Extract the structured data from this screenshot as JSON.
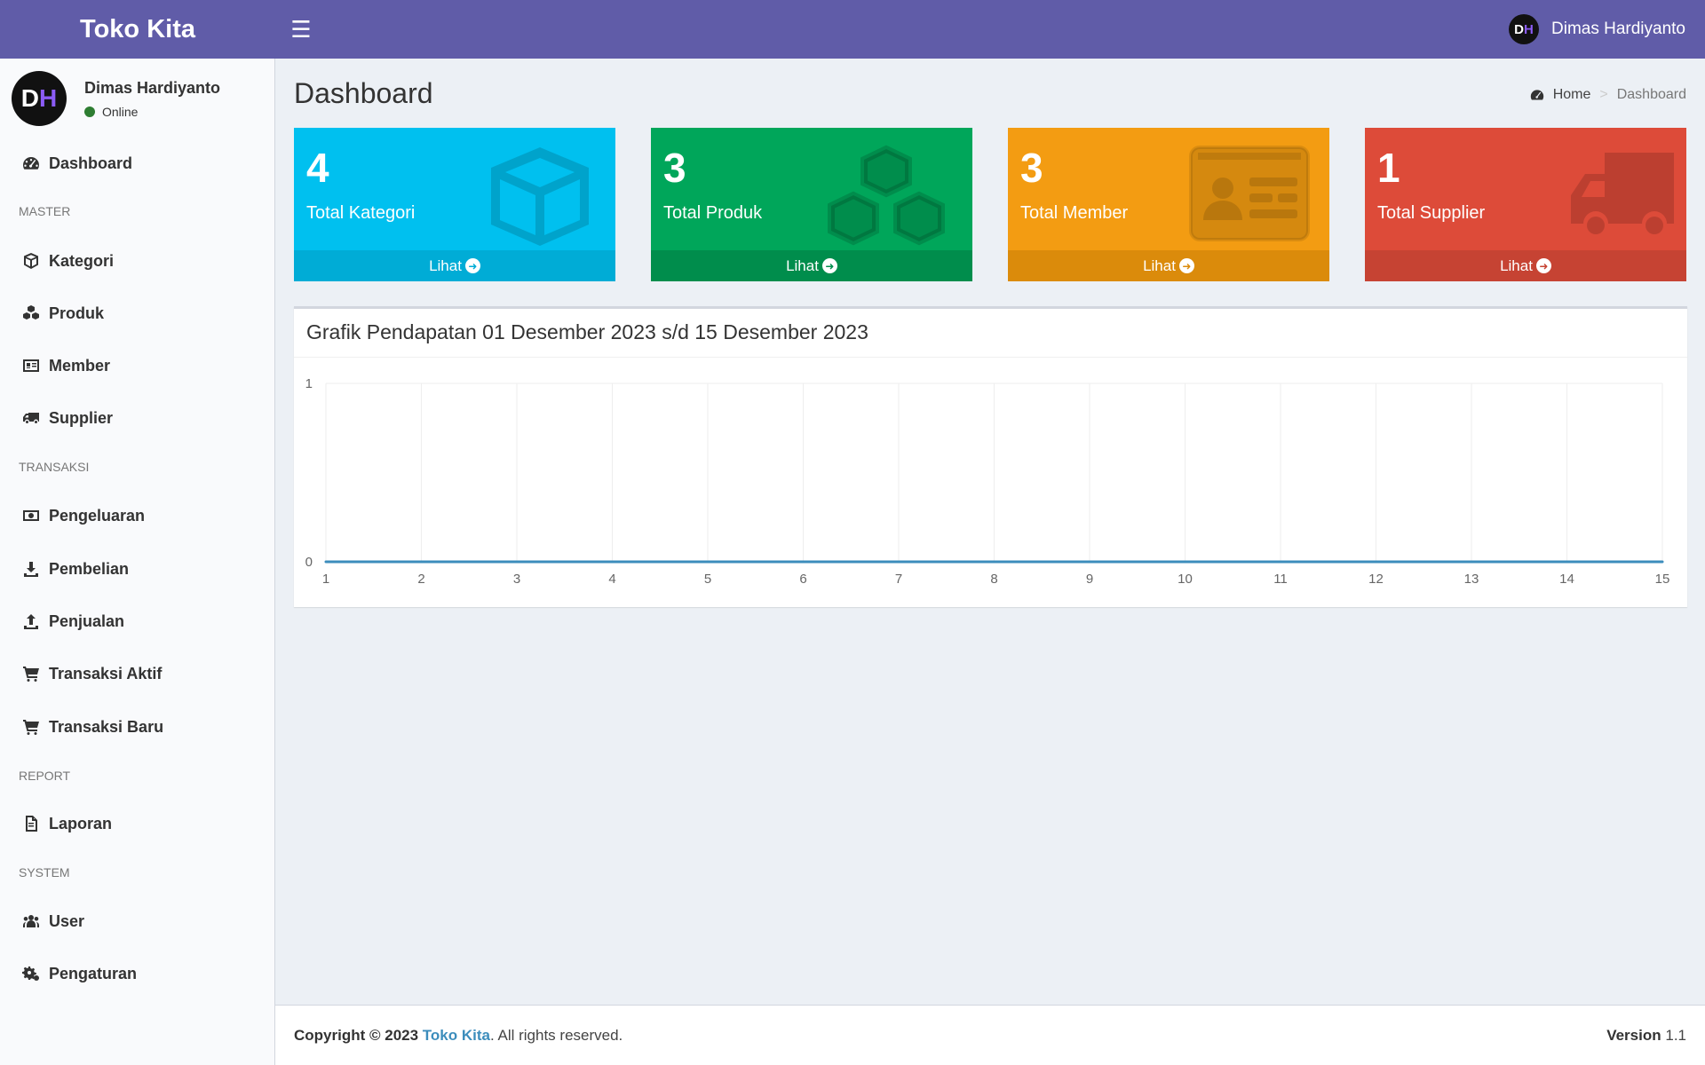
{
  "header": {
    "brand": "Toko Kita",
    "user_initials_d": "D",
    "user_initials_h": "H",
    "user_name": "Dimas Hardiyanto"
  },
  "sidebar": {
    "user_name": "Dimas Hardiyanto",
    "status": "Online",
    "items": [
      {
        "label": "Dashboard",
        "icon": "dashboard-icon"
      },
      {
        "label": "Kategori",
        "icon": "cube-icon"
      },
      {
        "label": "Produk",
        "icon": "cubes-icon"
      },
      {
        "label": "Member",
        "icon": "id-card-icon"
      },
      {
        "label": "Supplier",
        "icon": "truck-icon"
      },
      {
        "label": "Pengeluaran",
        "icon": "money-icon"
      },
      {
        "label": "Pembelian",
        "icon": "download-icon"
      },
      {
        "label": "Penjualan",
        "icon": "upload-icon"
      },
      {
        "label": "Transaksi Aktif",
        "icon": "cart-icon"
      },
      {
        "label": "Transaksi Baru",
        "icon": "cart-icon"
      },
      {
        "label": "Laporan",
        "icon": "file-pdf-icon"
      },
      {
        "label": "User",
        "icon": "users-icon"
      },
      {
        "label": "Pengaturan",
        "icon": "cogs-icon"
      }
    ],
    "headers": [
      "MASTER",
      "TRANSAKSI",
      "REPORT",
      "SYSTEM"
    ]
  },
  "page": {
    "title": "Dashboard",
    "breadcrumb_home": "Home",
    "breadcrumb_sep": ">",
    "breadcrumb_current": "Dashboard"
  },
  "boxes": [
    {
      "count": "4",
      "label": "Total Kategori",
      "link": "Lihat",
      "color": "#00c0ef",
      "footer_color": "#00acd6"
    },
    {
      "count": "3",
      "label": "Total Produk",
      "link": "Lihat",
      "color": "#00a65a",
      "footer_color": "#008d4c"
    },
    {
      "count": "3",
      "label": "Total Member",
      "link": "Lihat",
      "color": "#f39c12",
      "footer_color": "#db8b0b"
    },
    {
      "count": "1",
      "label": "Total Supplier",
      "link": "Lihat",
      "color": "#dd4b39",
      "footer_color": "#c64333"
    }
  ],
  "chart": {
    "title": "Grafik Pendapatan 01 Desember 2023 s/d 15 Desember 2023"
  },
  "chart_data": {
    "type": "line",
    "title": "Grafik Pendapatan 01 Desember 2023 s/d 15 Desember 2023",
    "x": [
      1,
      2,
      3,
      4,
      5,
      6,
      7,
      8,
      9,
      10,
      11,
      12,
      13,
      14,
      15
    ],
    "series": [
      {
        "values": [
          0,
          0,
          0,
          0,
          0,
          0,
          0,
          0,
          0,
          0,
          0,
          0,
          0,
          0,
          0
        ],
        "color": "#3c8dbc"
      }
    ],
    "ylim": [
      0,
      1
    ],
    "yticks": [
      0,
      1
    ],
    "grid": true,
    "xlabel": "",
    "ylabel": ""
  },
  "footer": {
    "copyright": "Copyright © 2023",
    "brand": "Toko Kita",
    "rights": ". All rights reserved.",
    "version_label": "Version",
    "version": "1.1"
  }
}
